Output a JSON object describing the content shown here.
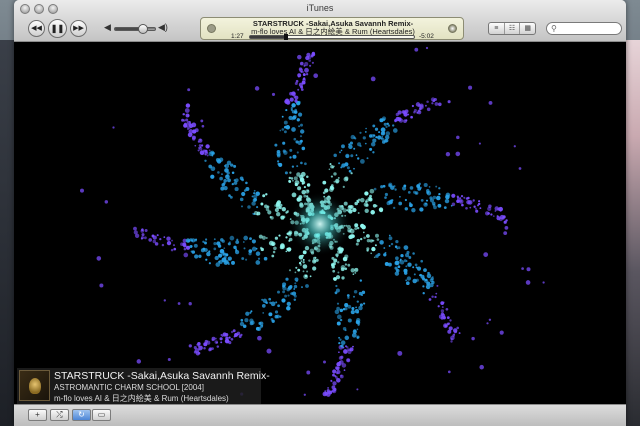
{
  "window": {
    "title": "iTunes"
  },
  "controls": {
    "previous_icon": "◀◀",
    "play_pause_icon": "❚❚",
    "next_icon": "▶▶",
    "volume_low_icon": "◀",
    "volume_high_icon": "◀)",
    "volume_level": 0.7
  },
  "lcd": {
    "track": "STARSTRUCK -Sakai,Asuka Savannh Remix-",
    "artist": "m-flo loves AI & 日之内絵美 & Rum (Heartsdales)",
    "elapsed": "1:27",
    "remaining": "-5:02",
    "progress": 0.22
  },
  "view_buttons": [
    "≡",
    "☷",
    "▦"
  ],
  "search": {
    "placeholder": ""
  },
  "now_playing": {
    "title": "STARSTRUCK -Sakai,Asuka Savannh Remix-",
    "album": "ASTROMANTIC CHARM SCHOOL [2004]",
    "artist": "m-flo loves AI & 日之内絵美 & Rum (Heartsdales)"
  },
  "bottom_buttons": {
    "add": "+",
    "shuffle": "⤮",
    "repeat": "↻",
    "show": "▭"
  },
  "colors": {
    "viz_core": "#8ff7f0",
    "viz_mid": "#2aa3e8",
    "viz_outer": "#7a4cff",
    "background": "#000000"
  }
}
